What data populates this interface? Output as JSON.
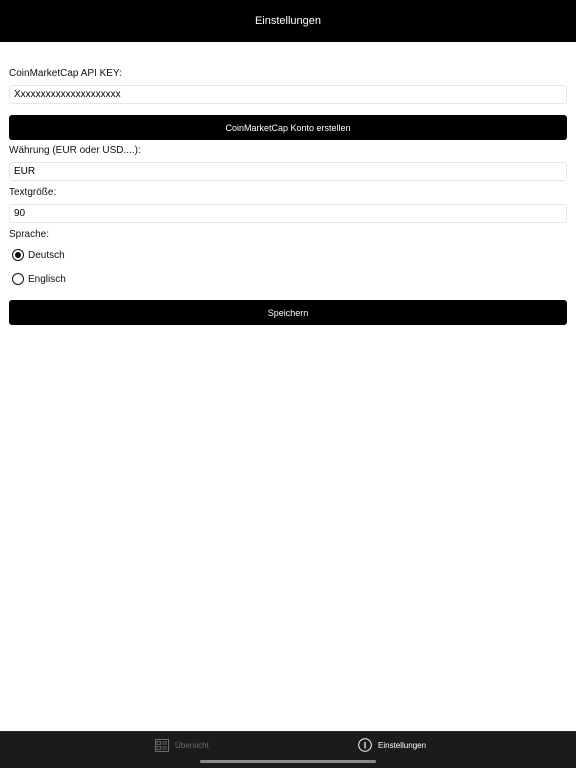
{
  "header": {
    "title": "Einstellungen"
  },
  "form": {
    "api_key_label": "CoinMarketCap API KEY:",
    "api_key_value": "Xxxxxxxxxxxxxxxxxxxxx",
    "create_account_button": "CoinMarketCap Konto erstellen",
    "currency_label": "Währung (EUR oder USD....):",
    "currency_value": "EUR",
    "text_size_label": "Textgröße:",
    "text_size_value": "90",
    "language_label": "Sprache:",
    "language_options": [
      {
        "label": "Deutsch",
        "selected": true
      },
      {
        "label": "Englisch",
        "selected": false
      }
    ],
    "save_button": "Speichern"
  },
  "tabbar": {
    "tabs": [
      {
        "label": "Übersicht",
        "icon": "list-icon",
        "active": false
      },
      {
        "label": "Einstellungen",
        "icon": "info-icon",
        "active": true
      }
    ]
  },
  "colors": {
    "nav_bg": "#000000",
    "button_bg": "#000000",
    "tabbar_bg": "#1b1b1b",
    "inactive_tab": "#6e6e6e"
  }
}
